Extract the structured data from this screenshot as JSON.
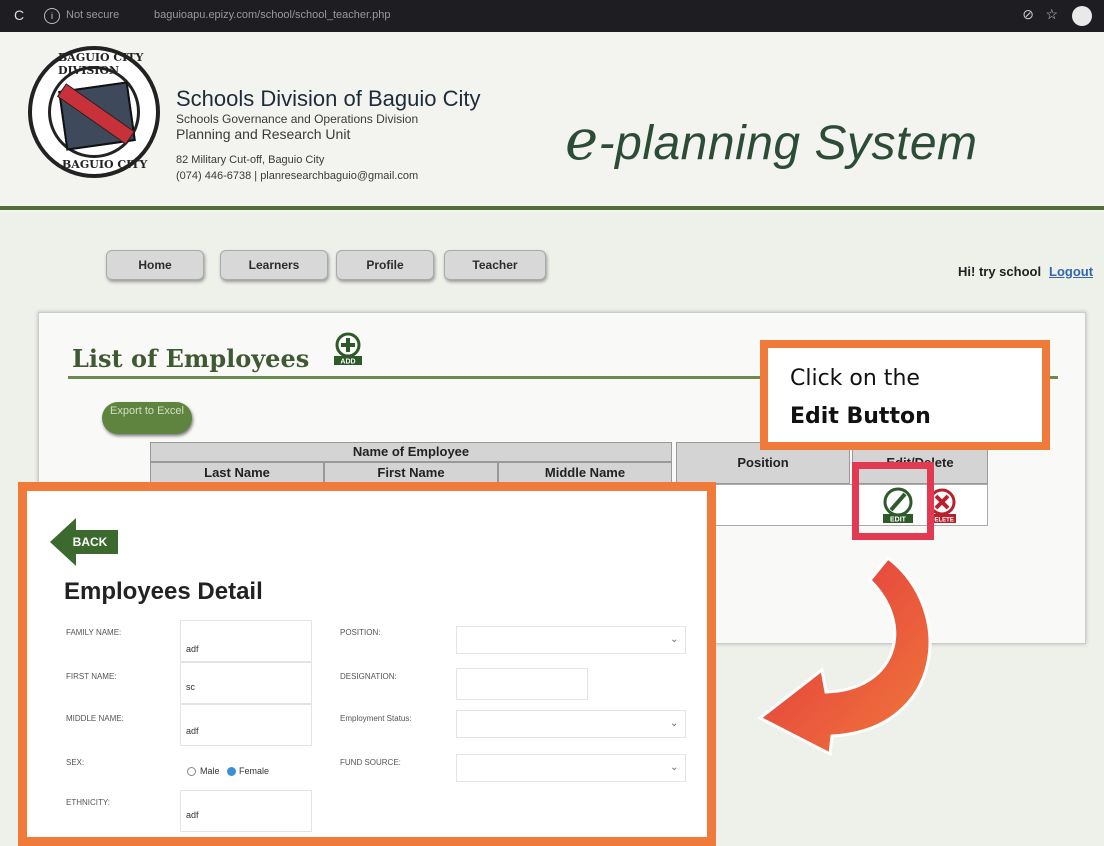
{
  "browser": {
    "status": "Not secure",
    "url": "baguioapu.epizy.com/school/school_teacher.php"
  },
  "header": {
    "logo": {
      "top_text": "BAGUIO CITY DIVISION",
      "bottom_text": "BAGUIO CITY"
    },
    "org_name": "Schools Division of Baguio City",
    "org_unit": "Schools Governance and Operations Division",
    "org_dept": "Planning and Research Unit",
    "address": "82 Military Cut-off, Baguio City",
    "contact": "(074) 446-6738 | planresearchbaguio@gmail.com",
    "system_title_e": "e",
    "system_title_rest": "-planning System"
  },
  "nav": {
    "items": [
      {
        "label": "Home"
      },
      {
        "label": "Learners"
      },
      {
        "label": "Profile"
      },
      {
        "label": "Teacher"
      }
    ],
    "greeting": "Hi! try school",
    "logout": "Logout"
  },
  "list": {
    "title": "List of Employees",
    "add_icon_text": "ADD",
    "export_label": "Export to Excel",
    "table": {
      "group_header": "Name of Employee",
      "columns": [
        "Last Name",
        "First Name",
        "Middle Name",
        "Position",
        "Edit/Delete"
      ]
    },
    "edit_icon_text": "EDIT",
    "delete_icon_text": "DELETE"
  },
  "callout": {
    "line1": "Click on the",
    "line2": "Edit Button"
  },
  "detail": {
    "back_label": "BACK",
    "title": "Employees Detail",
    "fields": {
      "family_name": {
        "label": "FAMILY NAME:",
        "value": "adf"
      },
      "first_name": {
        "label": "FIRST NAME:",
        "value": "sc"
      },
      "middle_name": {
        "label": "MIDDLE NAME:",
        "value": "adf"
      },
      "sex": {
        "label": "SEX:",
        "options": [
          "Male",
          "Female"
        ],
        "selected": "Female"
      },
      "ethnicity": {
        "label": "ETHNICITY:",
        "value": "adf"
      },
      "position": {
        "label": "POSITION:"
      },
      "designation": {
        "label": "DESIGNATION:"
      },
      "employment_status": {
        "label": "Employment Status:"
      },
      "fund_source": {
        "label": "FUND SOURCE:"
      }
    }
  },
  "colors": {
    "accent_orange": "#ef7a3a",
    "highlight_red": "#e23a53",
    "brand_green": "#3f5a32"
  }
}
